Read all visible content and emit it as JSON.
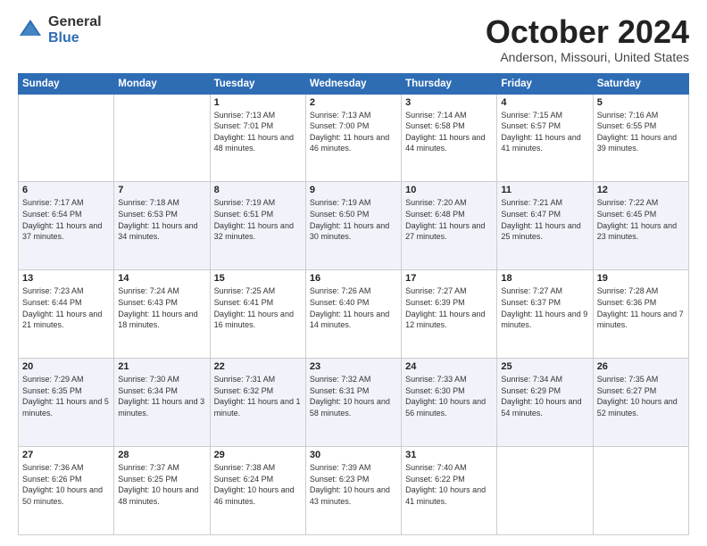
{
  "logo": {
    "general": "General",
    "blue": "Blue"
  },
  "header": {
    "month": "October 2024",
    "location": "Anderson, Missouri, United States"
  },
  "days_of_week": [
    "Sunday",
    "Monday",
    "Tuesday",
    "Wednesday",
    "Thursday",
    "Friday",
    "Saturday"
  ],
  "weeks": [
    [
      {
        "day": "",
        "info": ""
      },
      {
        "day": "",
        "info": ""
      },
      {
        "day": "1",
        "info": "Sunrise: 7:13 AM\nSunset: 7:01 PM\nDaylight: 11 hours and 48 minutes."
      },
      {
        "day": "2",
        "info": "Sunrise: 7:13 AM\nSunset: 7:00 PM\nDaylight: 11 hours and 46 minutes."
      },
      {
        "day": "3",
        "info": "Sunrise: 7:14 AM\nSunset: 6:58 PM\nDaylight: 11 hours and 44 minutes."
      },
      {
        "day": "4",
        "info": "Sunrise: 7:15 AM\nSunset: 6:57 PM\nDaylight: 11 hours and 41 minutes."
      },
      {
        "day": "5",
        "info": "Sunrise: 7:16 AM\nSunset: 6:55 PM\nDaylight: 11 hours and 39 minutes."
      }
    ],
    [
      {
        "day": "6",
        "info": "Sunrise: 7:17 AM\nSunset: 6:54 PM\nDaylight: 11 hours and 37 minutes."
      },
      {
        "day": "7",
        "info": "Sunrise: 7:18 AM\nSunset: 6:53 PM\nDaylight: 11 hours and 34 minutes."
      },
      {
        "day": "8",
        "info": "Sunrise: 7:19 AM\nSunset: 6:51 PM\nDaylight: 11 hours and 32 minutes."
      },
      {
        "day": "9",
        "info": "Sunrise: 7:19 AM\nSunset: 6:50 PM\nDaylight: 11 hours and 30 minutes."
      },
      {
        "day": "10",
        "info": "Sunrise: 7:20 AM\nSunset: 6:48 PM\nDaylight: 11 hours and 27 minutes."
      },
      {
        "day": "11",
        "info": "Sunrise: 7:21 AM\nSunset: 6:47 PM\nDaylight: 11 hours and 25 minutes."
      },
      {
        "day": "12",
        "info": "Sunrise: 7:22 AM\nSunset: 6:45 PM\nDaylight: 11 hours and 23 minutes."
      }
    ],
    [
      {
        "day": "13",
        "info": "Sunrise: 7:23 AM\nSunset: 6:44 PM\nDaylight: 11 hours and 21 minutes."
      },
      {
        "day": "14",
        "info": "Sunrise: 7:24 AM\nSunset: 6:43 PM\nDaylight: 11 hours and 18 minutes."
      },
      {
        "day": "15",
        "info": "Sunrise: 7:25 AM\nSunset: 6:41 PM\nDaylight: 11 hours and 16 minutes."
      },
      {
        "day": "16",
        "info": "Sunrise: 7:26 AM\nSunset: 6:40 PM\nDaylight: 11 hours and 14 minutes."
      },
      {
        "day": "17",
        "info": "Sunrise: 7:27 AM\nSunset: 6:39 PM\nDaylight: 11 hours and 12 minutes."
      },
      {
        "day": "18",
        "info": "Sunrise: 7:27 AM\nSunset: 6:37 PM\nDaylight: 11 hours and 9 minutes."
      },
      {
        "day": "19",
        "info": "Sunrise: 7:28 AM\nSunset: 6:36 PM\nDaylight: 11 hours and 7 minutes."
      }
    ],
    [
      {
        "day": "20",
        "info": "Sunrise: 7:29 AM\nSunset: 6:35 PM\nDaylight: 11 hours and 5 minutes."
      },
      {
        "day": "21",
        "info": "Sunrise: 7:30 AM\nSunset: 6:34 PM\nDaylight: 11 hours and 3 minutes."
      },
      {
        "day": "22",
        "info": "Sunrise: 7:31 AM\nSunset: 6:32 PM\nDaylight: 11 hours and 1 minute."
      },
      {
        "day": "23",
        "info": "Sunrise: 7:32 AM\nSunset: 6:31 PM\nDaylight: 10 hours and 58 minutes."
      },
      {
        "day": "24",
        "info": "Sunrise: 7:33 AM\nSunset: 6:30 PM\nDaylight: 10 hours and 56 minutes."
      },
      {
        "day": "25",
        "info": "Sunrise: 7:34 AM\nSunset: 6:29 PM\nDaylight: 10 hours and 54 minutes."
      },
      {
        "day": "26",
        "info": "Sunrise: 7:35 AM\nSunset: 6:27 PM\nDaylight: 10 hours and 52 minutes."
      }
    ],
    [
      {
        "day": "27",
        "info": "Sunrise: 7:36 AM\nSunset: 6:26 PM\nDaylight: 10 hours and 50 minutes."
      },
      {
        "day": "28",
        "info": "Sunrise: 7:37 AM\nSunset: 6:25 PM\nDaylight: 10 hours and 48 minutes."
      },
      {
        "day": "29",
        "info": "Sunrise: 7:38 AM\nSunset: 6:24 PM\nDaylight: 10 hours and 46 minutes."
      },
      {
        "day": "30",
        "info": "Sunrise: 7:39 AM\nSunset: 6:23 PM\nDaylight: 10 hours and 43 minutes."
      },
      {
        "day": "31",
        "info": "Sunrise: 7:40 AM\nSunset: 6:22 PM\nDaylight: 10 hours and 41 minutes."
      },
      {
        "day": "",
        "info": ""
      },
      {
        "day": "",
        "info": ""
      }
    ]
  ]
}
